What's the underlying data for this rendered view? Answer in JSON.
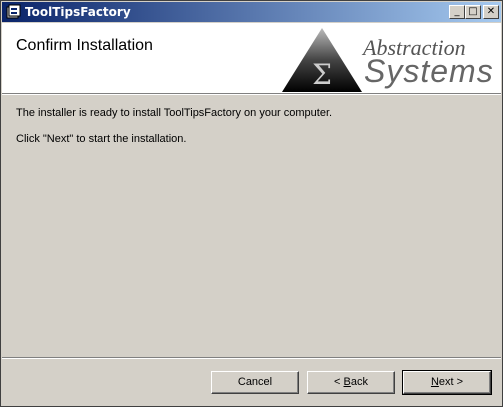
{
  "window": {
    "title": "ToolTipsFactory"
  },
  "titlebar_buttons": {
    "minimize": "_",
    "maximize": "□",
    "close": "✕"
  },
  "header": {
    "title": "Confirm Installation",
    "logo_line1": "Abstraction",
    "logo_line2": "Systems",
    "logo_symbol": "Σ"
  },
  "body": {
    "line1": "The installer is ready to install ToolTipsFactory on your computer.",
    "line2": "Click \"Next\" to start the installation."
  },
  "buttons": {
    "cancel": "Cancel",
    "back_arrow": "< ",
    "back_key": "B",
    "back_rest": "ack",
    "next_key": "N",
    "next_rest": "ext >"
  },
  "icons": [
    "app-icon",
    "minimize-icon",
    "maximize-icon",
    "close-icon",
    "abstraction-systems-logo"
  ]
}
